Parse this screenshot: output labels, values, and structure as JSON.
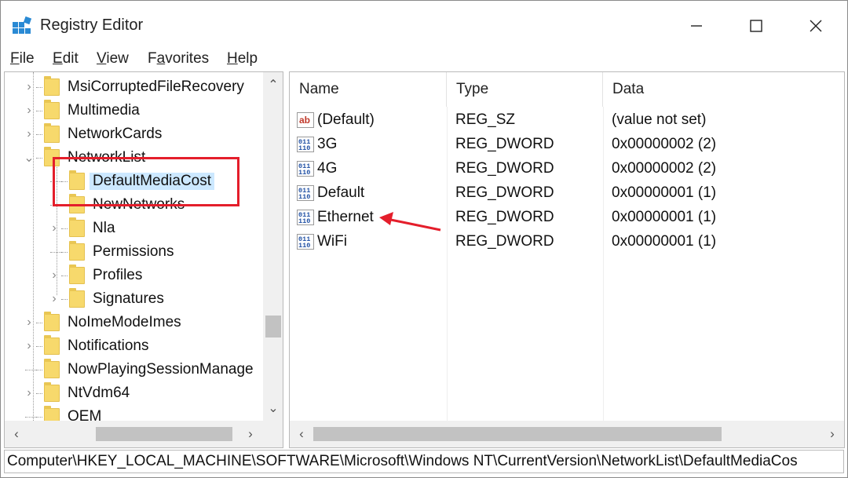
{
  "window": {
    "title": "Registry Editor"
  },
  "menu": [
    {
      "label": "File",
      "accel": "F",
      "rest": "ile"
    },
    {
      "label": "Edit",
      "accel": "E",
      "rest": "dit"
    },
    {
      "label": "View",
      "accel": "V",
      "rest": "iew"
    },
    {
      "label": "Favorites",
      "accel": "a",
      "pre": "F",
      "rest": "vorites"
    },
    {
      "label": "Help",
      "accel": "H",
      "rest": "elp"
    }
  ],
  "tree": {
    "items": [
      {
        "label": "MsiCorruptedFileRecovery",
        "level": 0,
        "expander": "collapsed"
      },
      {
        "label": "Multimedia",
        "level": 0,
        "expander": "collapsed"
      },
      {
        "label": "NetworkCards",
        "level": 0,
        "expander": "collapsed"
      },
      {
        "label": "NetworkList",
        "level": 0,
        "expander": "expanded"
      },
      {
        "label": "DefaultMediaCost",
        "level": 1,
        "expander": "none",
        "selected": true
      },
      {
        "label": "NewNetworks",
        "level": 1,
        "expander": "none"
      },
      {
        "label": "Nla",
        "level": 1,
        "expander": "collapsed"
      },
      {
        "label": "Permissions",
        "level": 1,
        "expander": "none"
      },
      {
        "label": "Profiles",
        "level": 1,
        "expander": "collapsed"
      },
      {
        "label": "Signatures",
        "level": 1,
        "expander": "collapsed"
      },
      {
        "label": "NoImeModeImes",
        "level": 0,
        "expander": "collapsed"
      },
      {
        "label": "Notifications",
        "level": 0,
        "expander": "collapsed"
      },
      {
        "label": "NowPlayingSessionManage",
        "level": 0,
        "expander": "none"
      },
      {
        "label": "NtVdm64",
        "level": 0,
        "expander": "collapsed"
      },
      {
        "label": "OEM",
        "level": 0,
        "expander": "none"
      }
    ]
  },
  "values": {
    "columns": [
      "Name",
      "Type",
      "Data"
    ],
    "rows": [
      {
        "name": "(Default)",
        "type": "REG_SZ",
        "data": "(value not set)",
        "icon": "string-value-icon"
      },
      {
        "name": "3G",
        "type": "REG_DWORD",
        "data": "0x00000002 (2)",
        "icon": "binary-value-icon"
      },
      {
        "name": "4G",
        "type": "REG_DWORD",
        "data": "0x00000002 (2)",
        "icon": "binary-value-icon"
      },
      {
        "name": "Default",
        "type": "REG_DWORD",
        "data": "0x00000001 (1)",
        "icon": "binary-value-icon"
      },
      {
        "name": "Ethernet",
        "type": "REG_DWORD",
        "data": "0x00000001 (1)",
        "icon": "binary-value-icon"
      },
      {
        "name": "WiFi",
        "type": "REG_DWORD",
        "data": "0x00000001 (1)",
        "icon": "binary-value-icon"
      }
    ]
  },
  "status": {
    "path": "Computer\\HKEY_LOCAL_MACHINE\\SOFTWARE\\Microsoft\\Windows NT\\CurrentVersion\\NetworkList\\DefaultMediaCos"
  },
  "colors": {
    "highlight": "#e41e2b",
    "selection": "#cce8ff",
    "folder": "#f7d96c"
  }
}
